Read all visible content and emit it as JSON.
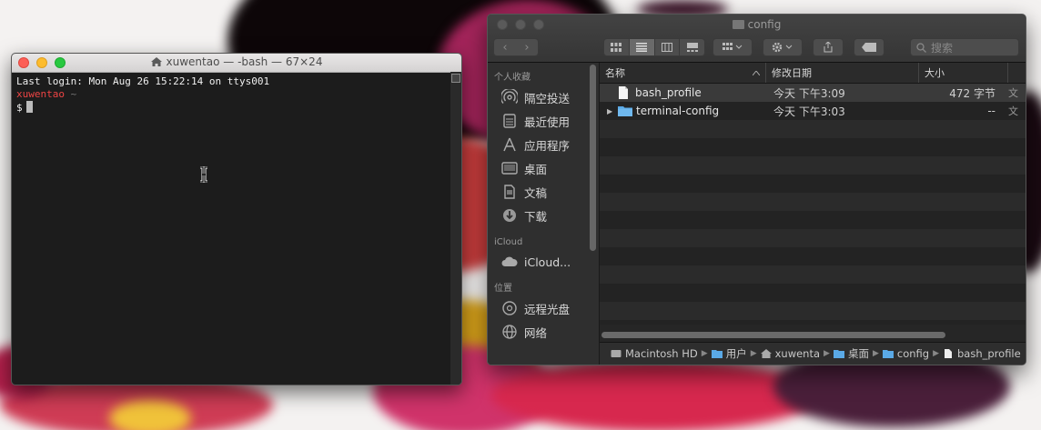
{
  "terminal": {
    "title": "xuwentao — -bash — 67×24",
    "lines": {
      "login": "Last login: Mon Aug 26 15:22:14 on ttys001",
      "user": "xuwentao",
      "tilde": "~",
      "prompt": "$"
    }
  },
  "finder": {
    "title": "config",
    "toolbar": {
      "back": "‹",
      "forward": "›",
      "search_placeholder": "搜索"
    },
    "sidebar": {
      "favorites_header": "个人收藏",
      "favorites": [
        {
          "label": "隔空投送",
          "icon": "airdrop-icon"
        },
        {
          "label": "最近使用",
          "icon": "recents-icon"
        },
        {
          "label": "应用程序",
          "icon": "applications-icon"
        },
        {
          "label": "桌面",
          "icon": "desktop-icon"
        },
        {
          "label": "文稿",
          "icon": "documents-icon"
        },
        {
          "label": "下载",
          "icon": "downloads-icon"
        }
      ],
      "icloud_header": "iCloud",
      "icloud": [
        {
          "label": "iCloud...",
          "icon": "cloud-icon"
        }
      ],
      "locations_header": "位置",
      "locations": [
        {
          "label": "远程光盘",
          "icon": "disc-icon"
        },
        {
          "label": "网络",
          "icon": "network-icon"
        }
      ]
    },
    "columns": {
      "name": "名称",
      "date": "修改日期",
      "size": "大小"
    },
    "files": [
      {
        "name": "bash_profile",
        "date": "今天 下午3:09",
        "size": "472 字节",
        "kind": "文"
      },
      {
        "name": "terminal-config",
        "date": "今天 下午3:03",
        "size": "--",
        "kind": "文"
      }
    ],
    "pathbar": {
      "disk": "Macintosh HD",
      "users": "用户",
      "home": "xuwenta",
      "desktop": "桌面",
      "config": "config",
      "file": "bash_profile"
    }
  }
}
